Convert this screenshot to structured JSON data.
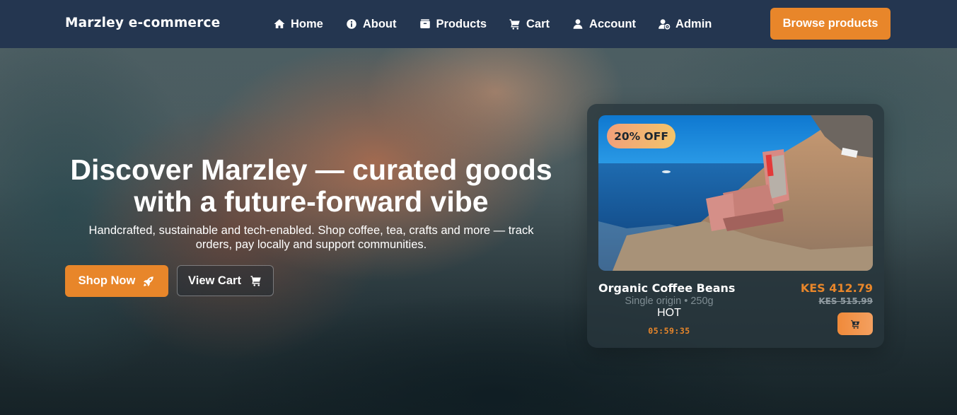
{
  "navbar": {
    "brand": "Marzley e-commerce",
    "links": [
      {
        "label": "Home",
        "icon": "home-icon"
      },
      {
        "label": "About",
        "icon": "info-icon"
      },
      {
        "label": "Products",
        "icon": "box-icon"
      },
      {
        "label": "Cart",
        "icon": "cart-icon"
      },
      {
        "label": "Account",
        "icon": "user-icon"
      },
      {
        "label": "Admin",
        "icon": "admin-user-icon"
      }
    ],
    "browse_label": "Browse products"
  },
  "hero": {
    "title": "Discover Marzley — curated goods with a future-forward vibe",
    "subtitle": "Handcrafted, sustainable and tech-enabled. Shop coffee, tea, crafts and more — track orders, pay locally and support communities.",
    "shop_now_label": "Shop Now",
    "shop_now_icon": "rocket-icon",
    "view_cart_label": "View Cart",
    "view_cart_icon": "cart-icon"
  },
  "product": {
    "discount": "20% OFF",
    "name": "Organic Coffee Beans",
    "description": "Single origin • 250g",
    "tag": "HOT",
    "timer": "05:59:35",
    "price": "KES 412.79",
    "old_price": "KES 515.99",
    "add_icon": "cart-plus-icon"
  },
  "colors": {
    "navbar": "#243650",
    "accent": "#e8862a",
    "card_bg": "#28363c",
    "muted_text": "#7f8d93"
  }
}
